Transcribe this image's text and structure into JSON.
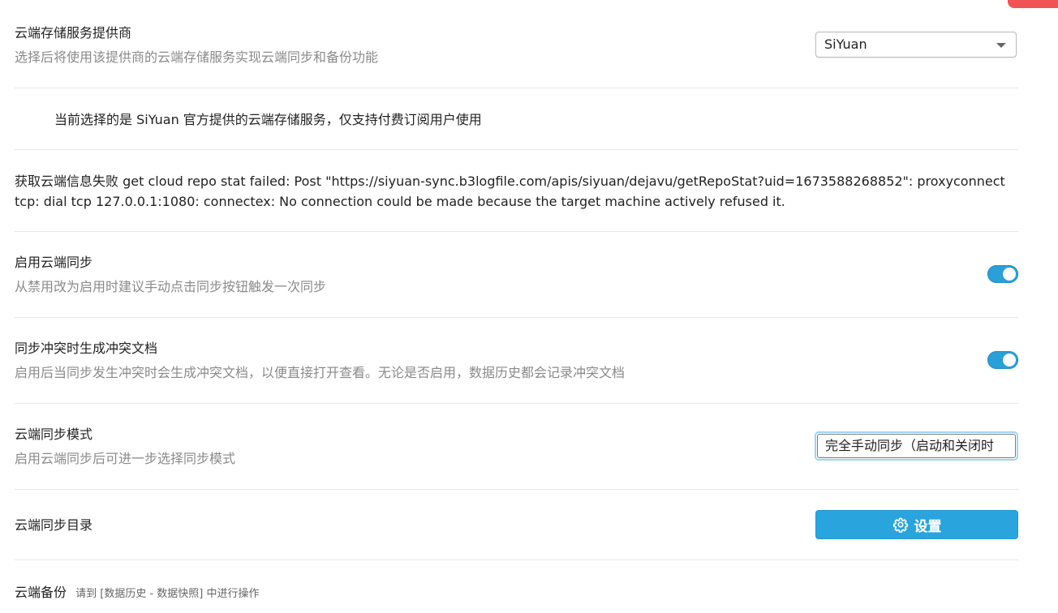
{
  "colors": {
    "accent": "#2a9fd8",
    "button": "#2aa4dc",
    "muted_text": "#8a8a8a",
    "corner_tab": "#f05454"
  },
  "provider": {
    "title": "云端存储服务提供商",
    "description": "选择后将使用该提供商的云端存储服务实现云端同步和备份功能",
    "selected": "SiYuan"
  },
  "provider_note": "当前选择的是 SiYuan 官方提供的云端存储服务，仅支持付费订阅用户使用",
  "error_message": "获取云端信息失败 get cloud repo stat failed: Post \"https://siyuan-sync.b3logfile.com/apis/siyuan/dejavu/getRepoStat?uid=1673588268852\": proxyconnect tcp: dial tcp 127.0.0.1:1080: connectex: No connection could be made because the target machine actively refused it.",
  "enable_sync": {
    "title": "启用云端同步",
    "description": "从禁用改为启用时建议手动点击同步按钮触发一次同步",
    "enabled": true
  },
  "conflict_doc": {
    "title": "同步冲突时生成冲突文档",
    "description": "启用后当同步发生冲突时会生成冲突文档，以便直接打开查看。无论是否启用，数据历史都会记录冲突文档",
    "enabled": true
  },
  "sync_mode": {
    "title": "云端同步模式",
    "description": "启用云端同步后可进一步选择同步模式",
    "selected": "完全手动同步（启动和关闭时"
  },
  "sync_dir": {
    "title": "云端同步目录",
    "button_label": "设置",
    "button_icon": "gear-icon"
  },
  "backup": {
    "title": "云端备份",
    "hint": "请到 [数据历史 - 数据快照] 中进行操作"
  }
}
